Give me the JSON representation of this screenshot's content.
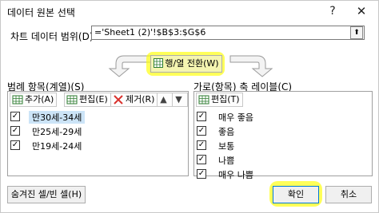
{
  "window": {
    "title": "데이터 원본 선택",
    "help_glyph": "?",
    "close_glyph": "✕"
  },
  "range": {
    "label": "차트 데이터 범위(D):",
    "value": "='Sheet1 (2)'!$B$3:$G$6",
    "collapse_glyph": "⬆"
  },
  "switch": {
    "label": "행/열 전환(W)"
  },
  "series_panel": {
    "title": "범례 항목(계열)(S)",
    "add_label": "추가(A)",
    "edit_label": "편집(E)",
    "remove_label": "제거(R)",
    "up_glyph": "▲",
    "down_glyph": "▼",
    "items": [
      {
        "label": "만30세-34세",
        "checked": true,
        "selected": true
      },
      {
        "label": "만25세-29세",
        "checked": true,
        "selected": false
      },
      {
        "label": "만19세-24세",
        "checked": true,
        "selected": false
      }
    ]
  },
  "category_panel": {
    "title": "가로(항목) 축 레이블(C)",
    "edit_label": "편집(T)",
    "items": [
      {
        "label": "매우 좋음",
        "checked": true
      },
      {
        "label": "좋음",
        "checked": true
      },
      {
        "label": "보통",
        "checked": true
      },
      {
        "label": "나쁨",
        "checked": true
      },
      {
        "label": "매우 나쁨",
        "checked": true
      }
    ]
  },
  "buttons": {
    "hidden_empty_cells": "숨겨진 셀/빈 셀(H)",
    "ok": "확인",
    "cancel": "취소"
  },
  "colors": {
    "highlight": "#ffff00",
    "selection": "#cce4f7",
    "accent": "#0078d7"
  }
}
